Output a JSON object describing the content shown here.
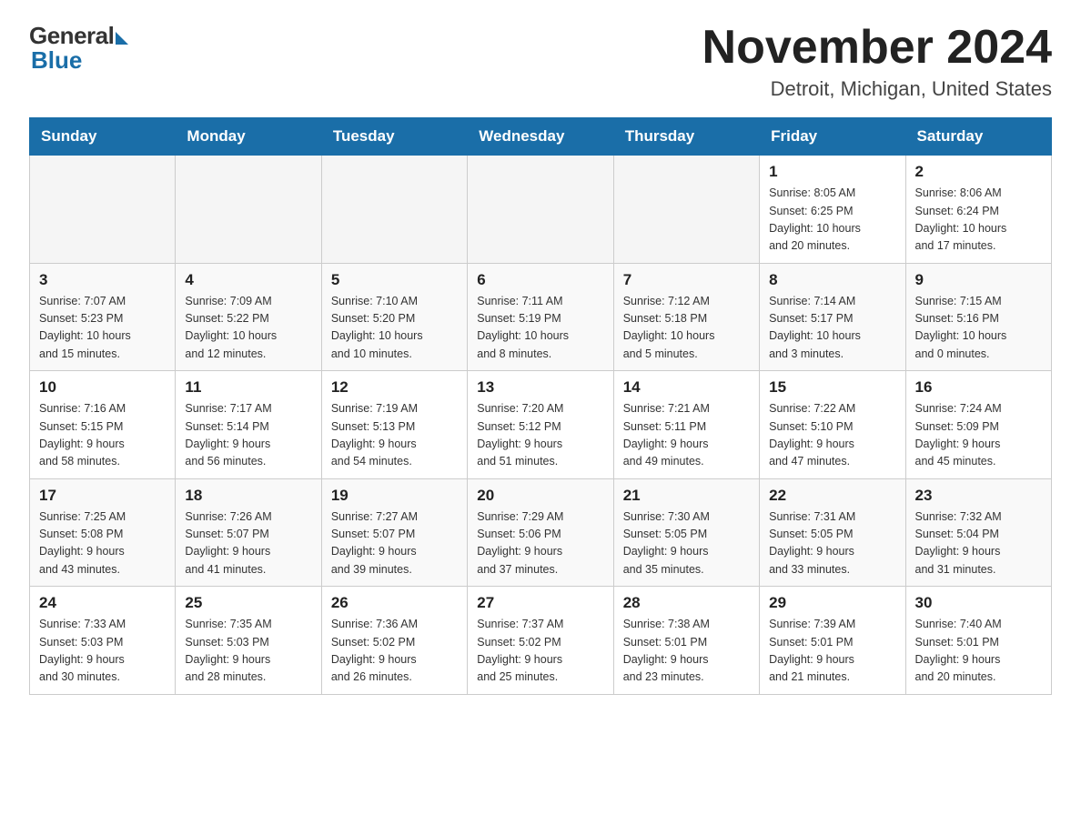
{
  "logo": {
    "general": "General",
    "blue": "Blue"
  },
  "title": "November 2024",
  "subtitle": "Detroit, Michigan, United States",
  "days_of_week": [
    "Sunday",
    "Monday",
    "Tuesday",
    "Wednesday",
    "Thursday",
    "Friday",
    "Saturday"
  ],
  "weeks": [
    [
      {
        "day": "",
        "info": ""
      },
      {
        "day": "",
        "info": ""
      },
      {
        "day": "",
        "info": ""
      },
      {
        "day": "",
        "info": ""
      },
      {
        "day": "",
        "info": ""
      },
      {
        "day": "1",
        "info": "Sunrise: 8:05 AM\nSunset: 6:25 PM\nDaylight: 10 hours\nand 20 minutes."
      },
      {
        "day": "2",
        "info": "Sunrise: 8:06 AM\nSunset: 6:24 PM\nDaylight: 10 hours\nand 17 minutes."
      }
    ],
    [
      {
        "day": "3",
        "info": "Sunrise: 7:07 AM\nSunset: 5:23 PM\nDaylight: 10 hours\nand 15 minutes."
      },
      {
        "day": "4",
        "info": "Sunrise: 7:09 AM\nSunset: 5:22 PM\nDaylight: 10 hours\nand 12 minutes."
      },
      {
        "day": "5",
        "info": "Sunrise: 7:10 AM\nSunset: 5:20 PM\nDaylight: 10 hours\nand 10 minutes."
      },
      {
        "day": "6",
        "info": "Sunrise: 7:11 AM\nSunset: 5:19 PM\nDaylight: 10 hours\nand 8 minutes."
      },
      {
        "day": "7",
        "info": "Sunrise: 7:12 AM\nSunset: 5:18 PM\nDaylight: 10 hours\nand 5 minutes."
      },
      {
        "day": "8",
        "info": "Sunrise: 7:14 AM\nSunset: 5:17 PM\nDaylight: 10 hours\nand 3 minutes."
      },
      {
        "day": "9",
        "info": "Sunrise: 7:15 AM\nSunset: 5:16 PM\nDaylight: 10 hours\nand 0 minutes."
      }
    ],
    [
      {
        "day": "10",
        "info": "Sunrise: 7:16 AM\nSunset: 5:15 PM\nDaylight: 9 hours\nand 58 minutes."
      },
      {
        "day": "11",
        "info": "Sunrise: 7:17 AM\nSunset: 5:14 PM\nDaylight: 9 hours\nand 56 minutes."
      },
      {
        "day": "12",
        "info": "Sunrise: 7:19 AM\nSunset: 5:13 PM\nDaylight: 9 hours\nand 54 minutes."
      },
      {
        "day": "13",
        "info": "Sunrise: 7:20 AM\nSunset: 5:12 PM\nDaylight: 9 hours\nand 51 minutes."
      },
      {
        "day": "14",
        "info": "Sunrise: 7:21 AM\nSunset: 5:11 PM\nDaylight: 9 hours\nand 49 minutes."
      },
      {
        "day": "15",
        "info": "Sunrise: 7:22 AM\nSunset: 5:10 PM\nDaylight: 9 hours\nand 47 minutes."
      },
      {
        "day": "16",
        "info": "Sunrise: 7:24 AM\nSunset: 5:09 PM\nDaylight: 9 hours\nand 45 minutes."
      }
    ],
    [
      {
        "day": "17",
        "info": "Sunrise: 7:25 AM\nSunset: 5:08 PM\nDaylight: 9 hours\nand 43 minutes."
      },
      {
        "day": "18",
        "info": "Sunrise: 7:26 AM\nSunset: 5:07 PM\nDaylight: 9 hours\nand 41 minutes."
      },
      {
        "day": "19",
        "info": "Sunrise: 7:27 AM\nSunset: 5:07 PM\nDaylight: 9 hours\nand 39 minutes."
      },
      {
        "day": "20",
        "info": "Sunrise: 7:29 AM\nSunset: 5:06 PM\nDaylight: 9 hours\nand 37 minutes."
      },
      {
        "day": "21",
        "info": "Sunrise: 7:30 AM\nSunset: 5:05 PM\nDaylight: 9 hours\nand 35 minutes."
      },
      {
        "day": "22",
        "info": "Sunrise: 7:31 AM\nSunset: 5:05 PM\nDaylight: 9 hours\nand 33 minutes."
      },
      {
        "day": "23",
        "info": "Sunrise: 7:32 AM\nSunset: 5:04 PM\nDaylight: 9 hours\nand 31 minutes."
      }
    ],
    [
      {
        "day": "24",
        "info": "Sunrise: 7:33 AM\nSunset: 5:03 PM\nDaylight: 9 hours\nand 30 minutes."
      },
      {
        "day": "25",
        "info": "Sunrise: 7:35 AM\nSunset: 5:03 PM\nDaylight: 9 hours\nand 28 minutes."
      },
      {
        "day": "26",
        "info": "Sunrise: 7:36 AM\nSunset: 5:02 PM\nDaylight: 9 hours\nand 26 minutes."
      },
      {
        "day": "27",
        "info": "Sunrise: 7:37 AM\nSunset: 5:02 PM\nDaylight: 9 hours\nand 25 minutes."
      },
      {
        "day": "28",
        "info": "Sunrise: 7:38 AM\nSunset: 5:01 PM\nDaylight: 9 hours\nand 23 minutes."
      },
      {
        "day": "29",
        "info": "Sunrise: 7:39 AM\nSunset: 5:01 PM\nDaylight: 9 hours\nand 21 minutes."
      },
      {
        "day": "30",
        "info": "Sunrise: 7:40 AM\nSunset: 5:01 PM\nDaylight: 9 hours\nand 20 minutes."
      }
    ]
  ]
}
